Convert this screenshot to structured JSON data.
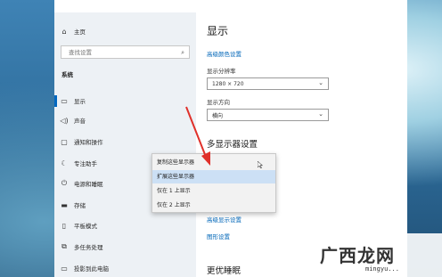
{
  "window": {
    "minimize": "—",
    "maximize": "□",
    "close": "✕"
  },
  "sidebar": {
    "home": "主页",
    "search_placeholder": "查找设置",
    "section": "系统",
    "items": [
      {
        "label": "显示",
        "icon": "display-icon"
      },
      {
        "label": "声音",
        "icon": "speaker-icon"
      },
      {
        "label": "通知和操作",
        "icon": "notification-icon"
      },
      {
        "label": "专注助手",
        "icon": "moon-icon"
      },
      {
        "label": "电源和睡眠",
        "icon": "power-icon"
      },
      {
        "label": "存储",
        "icon": "storage-icon"
      },
      {
        "label": "平板模式",
        "icon": "tablet-icon"
      },
      {
        "label": "多任务处理",
        "icon": "multitask-icon"
      },
      {
        "label": "投影到此电脑",
        "icon": "project-icon"
      }
    ]
  },
  "main": {
    "title": "显示",
    "advanced_color_link": "高级颜色设置",
    "resolution_label": "显示分辨率",
    "resolution_value": "1280 × 720",
    "orientation_label": "显示方向",
    "orientation_value": "横向",
    "multi_display_heading": "多显示器设置",
    "dropdown_options": [
      "复制这些显示器",
      "扩展这些显示器",
      "仅在 1 上显示",
      "仅在 2 上显示"
    ],
    "selected_option_index": 1,
    "advanced_display_link": "高级显示设置",
    "graphics_link": "图形设置",
    "sleep_heading": "更优睡眠"
  },
  "watermark": {
    "text": "广西龙网",
    "url": "mingyu..."
  },
  "colors": {
    "accent": "#0067c0",
    "link": "#0066b8",
    "arrow": "#e0302a"
  }
}
